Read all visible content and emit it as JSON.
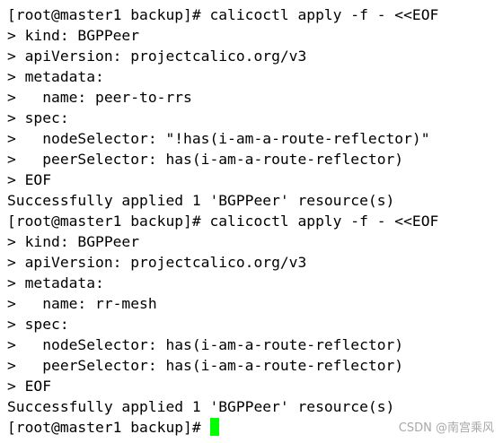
{
  "terminal": {
    "lines": [
      "[root@master1 backup]# calicoctl apply -f - <<EOF",
      "> kind: BGPPeer",
      "> apiVersion: projectcalico.org/v3",
      "> metadata:",
      ">   name: peer-to-rrs",
      "> spec:",
      ">   nodeSelector: \"!has(i-am-a-route-reflector)\"",
      ">   peerSelector: has(i-am-a-route-reflector)",
      "> EOF",
      "Successfully applied 1 'BGPPeer' resource(s)",
      "[root@master1 backup]# calicoctl apply -f - <<EOF",
      "> kind: BGPPeer",
      "> apiVersion: projectcalico.org/v3",
      "> metadata:",
      ">   name: rr-mesh",
      "> spec:",
      ">   nodeSelector: has(i-am-a-route-reflector)",
      ">   peerSelector: has(i-am-a-route-reflector)",
      "> EOF",
      "Successfully applied 1 'BGPPeer' resource(s)"
    ],
    "prompt": "[root@master1 backup]# ",
    "cursor_color": "#00ff00"
  },
  "watermark": "CSDN @南宫乘风"
}
